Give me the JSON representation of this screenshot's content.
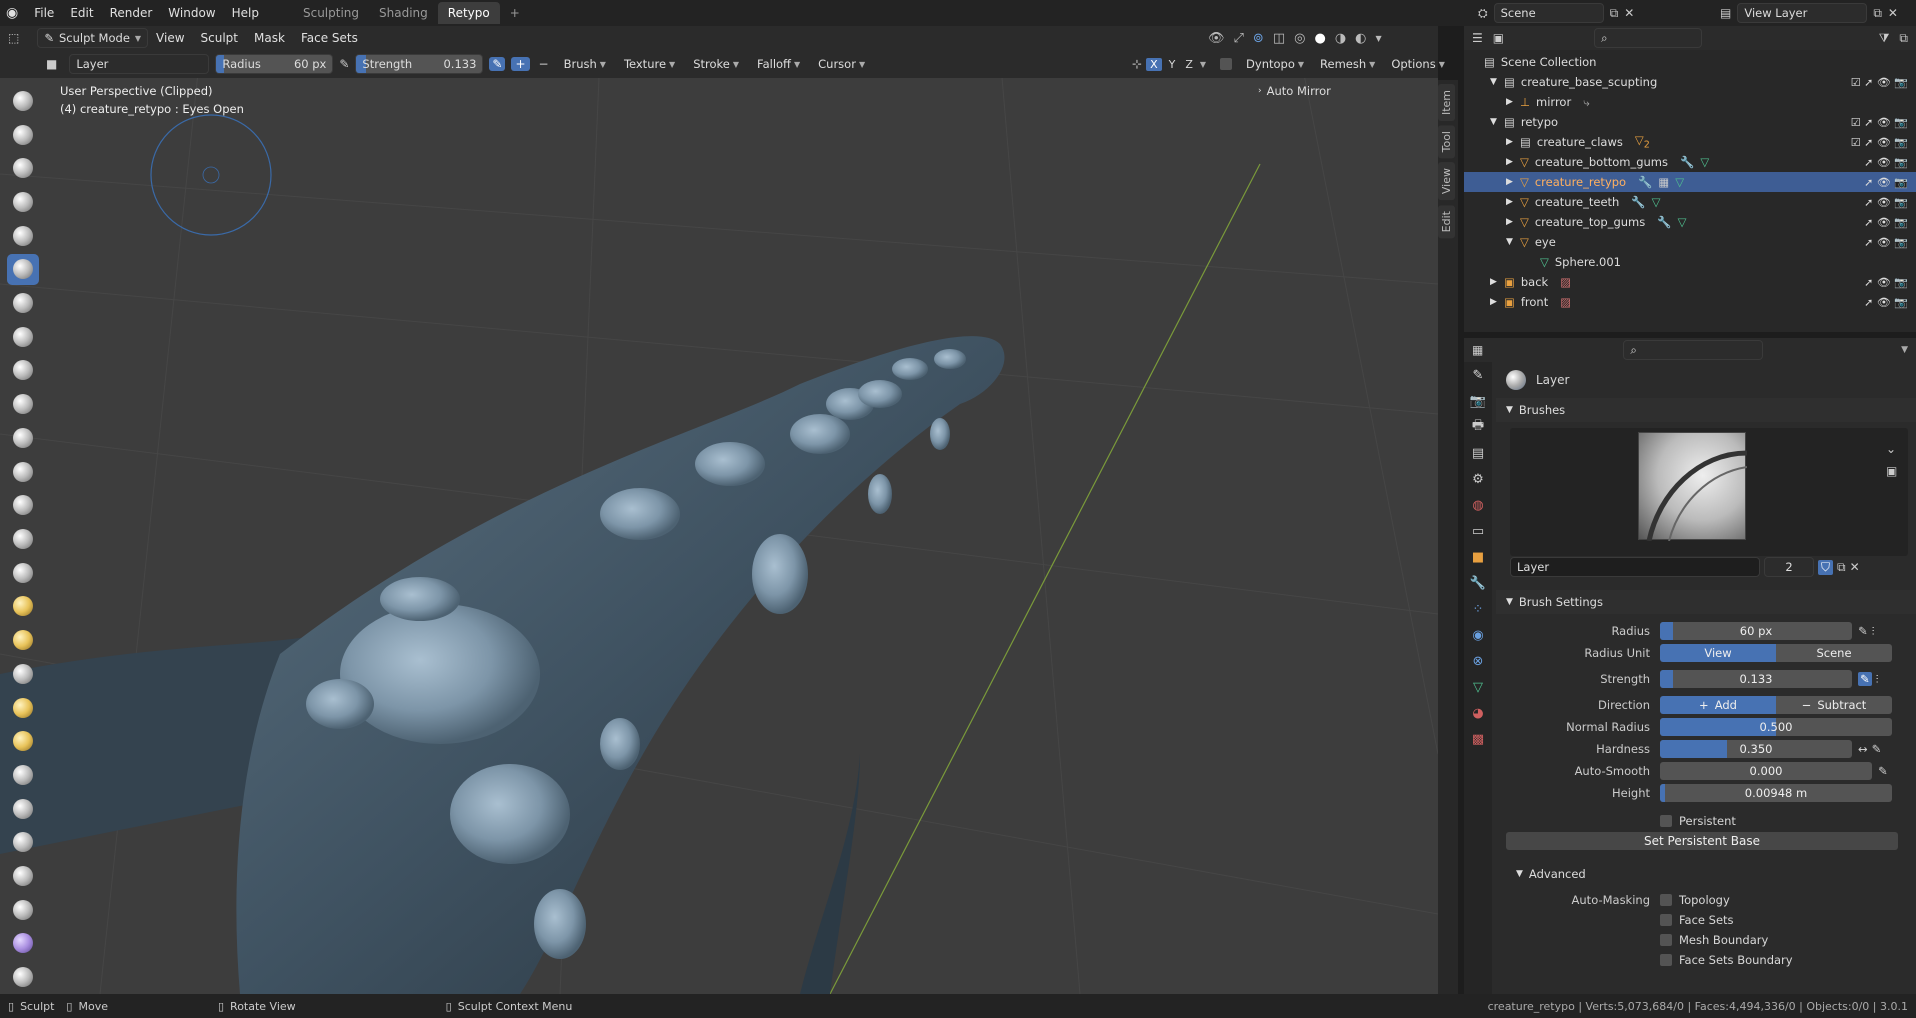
{
  "app": {
    "logo": "blender-logo"
  },
  "menu": [
    "File",
    "Edit",
    "Render",
    "Window",
    "Help"
  ],
  "workspaces": [
    "Sculpting",
    "Shading",
    "Retypo"
  ],
  "active_workspace": "Retypo",
  "add_tab": "+",
  "scene": "Scene",
  "view_layer": "View Layer",
  "header": {
    "mode": "Sculpt Mode",
    "menus": [
      "View",
      "Sculpt",
      "Mask",
      "Face Sets"
    ]
  },
  "tool_header": {
    "brush_name": "Layer",
    "radius_label": "Radius",
    "radius_value": "60 px",
    "strength_label": "Strength",
    "strength_value": "0.133",
    "menus": [
      "Brush",
      "Texture",
      "Stroke",
      "Falloff",
      "Cursor"
    ],
    "axes": [
      "X",
      "Y",
      "Z"
    ],
    "dyntopo": "Dyntopo",
    "remesh": "Remesh",
    "options": "Options"
  },
  "viewport": {
    "line1": "User Perspective (Clipped)",
    "line2": "(4) creature_retypo : Eyes Open",
    "auto_mirror": "Auto Mirror"
  },
  "side_tabs": [
    "Item",
    "Tool",
    "View",
    "Edit"
  ],
  "outliner": {
    "title": "Scene Collection",
    "rows": [
      {
        "label": "creature_base_scupting",
        "indent": 1
      },
      {
        "label": "mirror",
        "indent": 2
      },
      {
        "label": "retypo",
        "indent": 1
      },
      {
        "label": "creature_claws",
        "indent": 2,
        "badge": "2"
      },
      {
        "label": "creature_bottom_gums",
        "indent": 2
      },
      {
        "label": "creature_retypo",
        "indent": 2,
        "selected": true
      },
      {
        "label": "creature_teeth",
        "indent": 2
      },
      {
        "label": "creature_top_gums",
        "indent": 2
      },
      {
        "label": "eye",
        "indent": 2
      },
      {
        "label": "Sphere.001",
        "indent": 3
      },
      {
        "label": "back",
        "indent": 1
      },
      {
        "label": "front",
        "indent": 1
      }
    ]
  },
  "props": {
    "brush_title": "Layer",
    "brushes_panel": "Brushes",
    "brush_field": "Layer",
    "brush_users": "2",
    "settings_panel": "Brush Settings",
    "radius": {
      "label": "Radius",
      "value": "60 px",
      "fraction": 0.07
    },
    "radius_unit": {
      "label": "Radius Unit",
      "a": "View",
      "b": "Scene"
    },
    "strength": {
      "label": "Strength",
      "value": "0.133",
      "fraction": 0.07
    },
    "direction": {
      "label": "Direction",
      "a": "Add",
      "b": "Subtract"
    },
    "normal_radius": {
      "label": "Normal Radius",
      "value": "0.500",
      "fraction": 0.5
    },
    "hardness": {
      "label": "Hardness",
      "value": "0.350",
      "fraction": 0.35
    },
    "auto_smooth": {
      "label": "Auto-Smooth",
      "value": "0.000",
      "fraction": 0.0
    },
    "height": {
      "label": "Height",
      "value": "0.00948 m",
      "fraction": 0.02
    },
    "persistent": "Persistent",
    "set_base": "Set Persistent Base",
    "advanced": "Advanced",
    "auto_masking": "Auto-Masking",
    "masking": [
      "Topology",
      "Face Sets",
      "Mesh Boundary",
      "Face Sets Boundary"
    ]
  },
  "status": {
    "sculpt": "Sculpt",
    "move": "Move",
    "rotate": "Rotate View",
    "context": "Sculpt Context Menu",
    "stats": "creature_retypo | Verts:5,073,684/0 | Faces:4,494,336/0 | Objects:0/0 | 3.0.1"
  }
}
